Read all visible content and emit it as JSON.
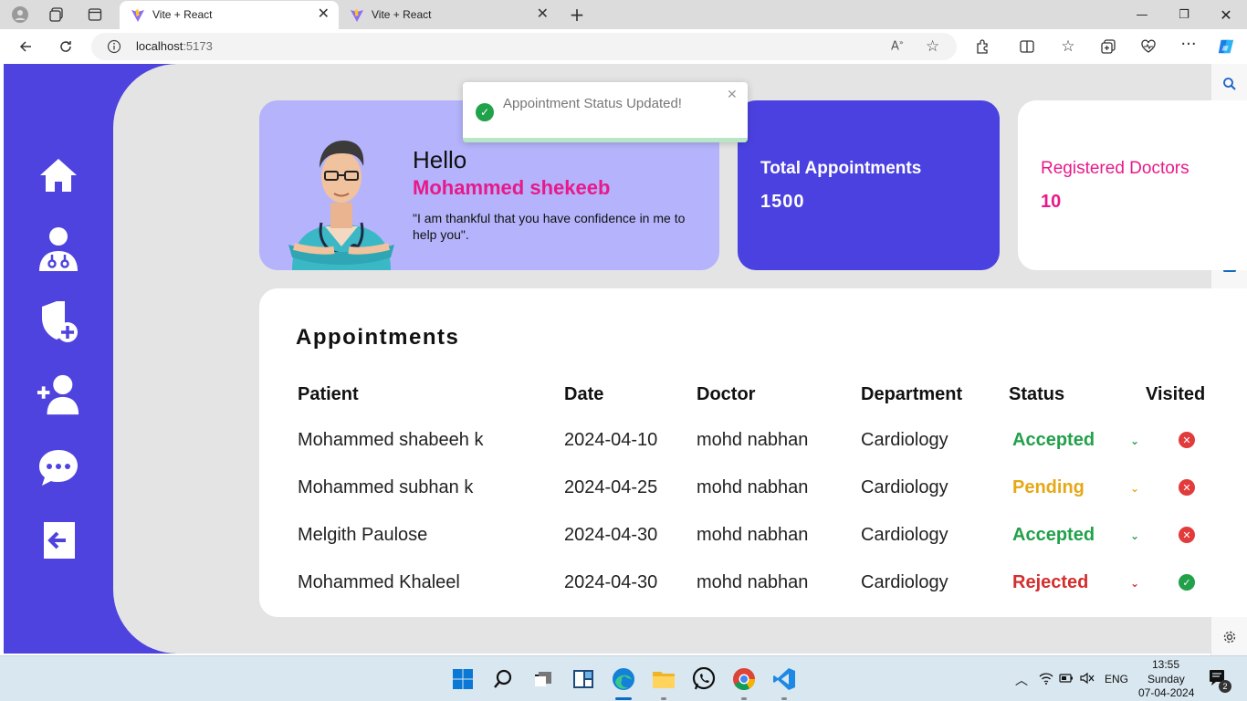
{
  "browser": {
    "tabs": [
      {
        "label": "Vite + React",
        "active": true
      },
      {
        "label": "Vite + React",
        "active": false
      }
    ],
    "url_host": "localhost",
    "url_port": ":5173"
  },
  "toast": {
    "message": "Appointment Status Updated!"
  },
  "greeting": {
    "hello": "Hello",
    "name": "Mohammed shekeeb",
    "quote": "\"I am thankful that you have confidence in me to help you\"."
  },
  "stats": {
    "total_label": "Total Appointments",
    "total_value": "1500",
    "doctors_label": "Registered Doctors",
    "doctors_value": "10"
  },
  "appointments": {
    "title": "Appointments",
    "headers": [
      "Patient",
      "Date",
      "Doctor",
      "Department",
      "Status",
      "Visited"
    ],
    "rows": [
      {
        "patient": "Mohammed shabeeh k",
        "date": "2024-04-10",
        "doctor": "mohd nabhan",
        "department": "Cardiology",
        "status": "Accepted",
        "status_color": "#22a04a",
        "visited": false
      },
      {
        "patient": "Mohammed subhan k",
        "date": "2024-04-25",
        "doctor": "mohd nabhan",
        "department": "Cardiology",
        "status": "Pending",
        "status_color": "#e6a817",
        "visited": false
      },
      {
        "patient": "Melgith Paulose",
        "date": "2024-04-30",
        "doctor": "mohd nabhan",
        "department": "Cardiology",
        "status": "Accepted",
        "status_color": "#22a04a",
        "visited": false
      },
      {
        "patient": "Mohammed Khaleel",
        "date": "2024-04-30",
        "doctor": "mohd nabhan",
        "department": "Cardiology",
        "status": "Rejected",
        "status_color": "#d32f2f",
        "visited": true
      }
    ]
  },
  "sidebar_icons": [
    "home-icon",
    "doctor-icon",
    "shield-plus-icon",
    "add-user-icon",
    "chat-icon",
    "logout-icon"
  ],
  "colors": {
    "accent": "#4f43df",
    "pink": "#e8198b",
    "card_light": "#b4b3fb"
  },
  "taskbar": {
    "language": "ENG",
    "time": "13:55",
    "day": "Sunday",
    "date": "07-04-2024",
    "notifications": "2"
  }
}
